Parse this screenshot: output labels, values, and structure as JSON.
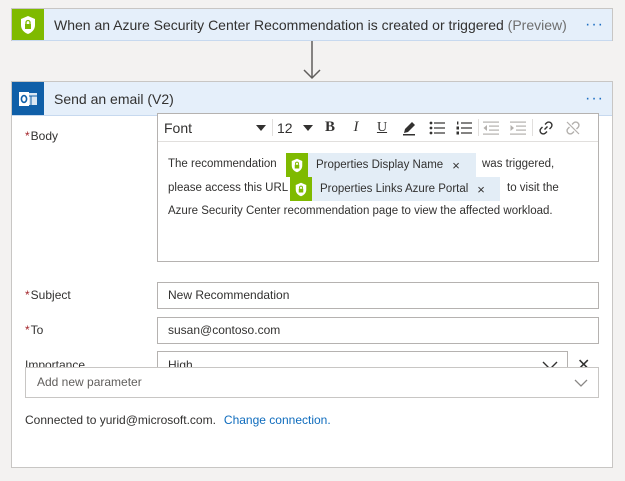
{
  "trigger": {
    "title": "When an Azure Security Center Recommendation is created or triggered",
    "badge": "(Preview)",
    "more": "···"
  },
  "action": {
    "title": "Send an email (V2)",
    "more": "···"
  },
  "body": {
    "label": "Body",
    "required": "*",
    "toolbar": {
      "font": "Font",
      "size": "12",
      "bold": "B",
      "italic": "I",
      "underline": "U"
    },
    "text1": "The recommendation",
    "token1": "Properties Display Name",
    "text2": "was triggered,",
    "text3": "please access this URL",
    "token2": "Properties Links Azure Portal",
    "text4": "to visit the",
    "text5": "Azure Security Center recommendation page to view the affected workload.",
    "token_remove": "×"
  },
  "subject": {
    "label": "Subject",
    "required": "*",
    "value": "New Recommendation"
  },
  "to": {
    "label": "To",
    "required": "*",
    "value": "susan@contoso.com"
  },
  "importance": {
    "label": "Importance",
    "value": "High",
    "clear": "✕"
  },
  "add_param": {
    "placeholder": "Add new parameter"
  },
  "connection": {
    "text": "Connected to yurid@microsoft.com.",
    "link": "Change connection."
  },
  "colors": {
    "security_green": "#7fba00",
    "header_blue": "#e5effa",
    "outlook_blue": "#0f5fa8",
    "link": "#0f6cbd",
    "required": "#a4262c"
  }
}
